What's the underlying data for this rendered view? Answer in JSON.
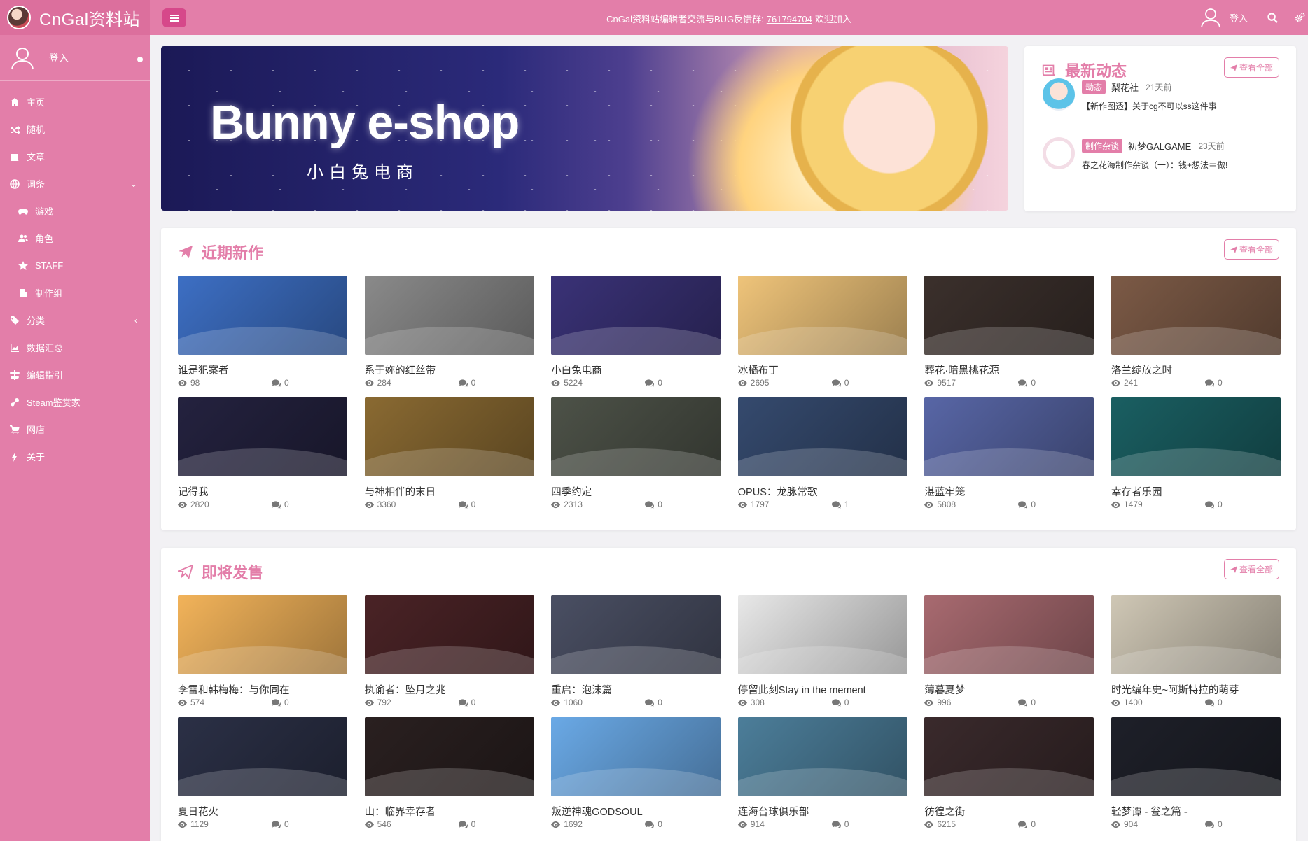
{
  "brand": {
    "name": "CnGal资料站"
  },
  "sidebar": {
    "login": "登入",
    "items": [
      {
        "label": "主页",
        "icon": "home-icon"
      },
      {
        "label": "随机",
        "icon": "shuffle-icon"
      },
      {
        "label": "文章",
        "icon": "newspaper-icon"
      },
      {
        "label": "词条",
        "icon": "globe-icon",
        "caret": "⌄"
      },
      {
        "label": "游戏",
        "icon": "gamepad-icon",
        "sub": true
      },
      {
        "label": "角色",
        "icon": "users-icon",
        "sub": true
      },
      {
        "label": "STAFF",
        "icon": "star-icon",
        "sub": true
      },
      {
        "label": "制作组",
        "icon": "building-icon",
        "sub": true
      },
      {
        "label": "分类",
        "icon": "tags-icon",
        "caret": "‹"
      },
      {
        "label": "数据汇总",
        "icon": "area-chart-icon"
      },
      {
        "label": "编辑指引",
        "icon": "signpost-icon"
      },
      {
        "label": "Steam鉴赏家",
        "icon": "steam-icon"
      },
      {
        "label": "网店",
        "icon": "cart-icon"
      },
      {
        "label": "关于",
        "icon": "bolt-icon"
      }
    ]
  },
  "topbar": {
    "notice_text": "CnGal资料站编辑者交流与BUG反馈群:",
    "notice_qq": "761794704",
    "notice_suffix": "欢迎加入",
    "login": "登入",
    "menu_icon": "hamburger-icon",
    "search_icon": "search-icon",
    "settings_icon": "cogs-icon"
  },
  "banner": {
    "title": "Bunny e-shop",
    "subtitle": "小白兔电商"
  },
  "news": {
    "title": "最新动态",
    "view_all": "查看全部",
    "items": [
      {
        "tag": "动态",
        "author": "梨花社",
        "time": "21天前",
        "text": "【新作图透】关于cg不可以ss这件事"
      },
      {
        "tag": "制作杂谈",
        "author": "初梦GALGAME",
        "time": "23天前",
        "text": "春之花海制作杂谈（一）：钱+想法＝做!"
      }
    ]
  },
  "recent": {
    "title": "近期新作",
    "view_all": "查看全部",
    "games": [
      {
        "name": "谁是犯案者",
        "views": "98",
        "comments": "0",
        "color": "#3d6fc4"
      },
      {
        "name": "系于妳的红丝带",
        "views": "284",
        "comments": "0",
        "color": "#8a8a8a"
      },
      {
        "name": "小白兔电商",
        "views": "5224",
        "comments": "0",
        "color": "#3a3277"
      },
      {
        "name": "冰橘布丁",
        "views": "2695",
        "comments": "0",
        "color": "#efc47a"
      },
      {
        "name": "葬花·暗黑桃花源",
        "views": "9517",
        "comments": "0",
        "color": "#3b302c"
      },
      {
        "name": "洛兰绽放之时",
        "views": "241",
        "comments": "0",
        "color": "#7c5a46"
      },
      {
        "name": "记得我",
        "views": "2820",
        "comments": "0",
        "color": "#24223f"
      },
      {
        "name": "与神相伴的末日",
        "views": "3360",
        "comments": "0",
        "color": "#8a6a32"
      },
      {
        "name": "四季约定",
        "views": "2313",
        "comments": "0",
        "color": "#4d5248"
      },
      {
        "name": "OPUS：龙脉常歌",
        "views": "1797",
        "comments": "1",
        "color": "#354a6e"
      },
      {
        "name": "湛蓝牢笼",
        "views": "5808",
        "comments": "0",
        "color": "#5866a6"
      },
      {
        "name": "幸存者乐园",
        "views": "1479",
        "comments": "0",
        "color": "#1a5f62"
      }
    ]
  },
  "upcoming": {
    "title": "即将发售",
    "view_all": "查看全部",
    "games": [
      {
        "name": "李雷和韩梅梅：与你同在",
        "views": "574",
        "comments": "0",
        "color": "#f2b35a"
      },
      {
        "name": "执谕者：坠月之兆",
        "views": "792",
        "comments": "0",
        "color": "#4a2326"
      },
      {
        "name": "重启：泡沫篇",
        "views": "1060",
        "comments": "0",
        "color": "#4a4f63"
      },
      {
        "name": "停留此刻Stay in the mement",
        "views": "308",
        "comments": "0",
        "color": "#e8e8e8"
      },
      {
        "name": "薄暮夏梦",
        "views": "996",
        "comments": "0",
        "color": "#a86a70"
      },
      {
        "name": "时光编年史~阿斯特拉的萌芽",
        "views": "1400",
        "comments": "0",
        "color": "#cfc7b5"
      },
      {
        "name": "夏日花火",
        "views": "1129",
        "comments": "0",
        "color": "#2b3046"
      },
      {
        "name": "山：临界幸存者",
        "views": "546",
        "comments": "0",
        "color": "#2a2020"
      },
      {
        "name": "叛逆神魂GODSOUL",
        "views": "1692",
        "comments": "0",
        "color": "#6aa9e6"
      },
      {
        "name": "连海台球俱乐部",
        "views": "914",
        "comments": "0",
        "color": "#4c7e9a"
      },
      {
        "name": "彷徨之街",
        "views": "6215",
        "comments": "0",
        "color": "#3a2a2c"
      },
      {
        "name": "轻梦谭 - 瓮之篇 -",
        "views": "904",
        "comments": "0",
        "color": "#1e2029"
      }
    ]
  }
}
